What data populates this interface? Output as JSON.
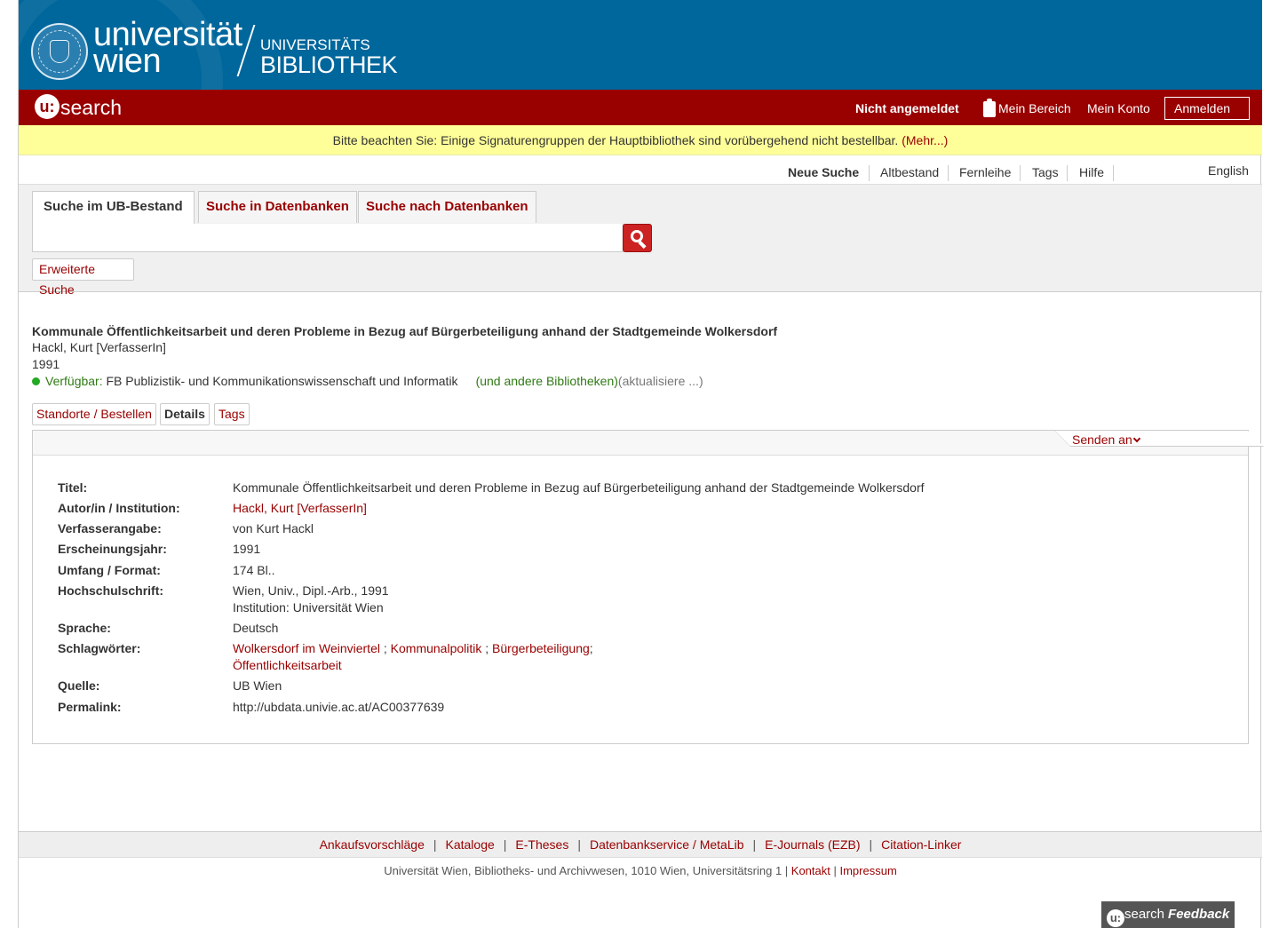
{
  "header": {
    "uni_line1": "universität",
    "uni_line2": "wien",
    "ub_line1": "UNIVERSITÄTS",
    "ub_line2": "BIBLIOTHEK"
  },
  "topbar": {
    "logo_u": "u:",
    "logo_text": "search",
    "login_status": "Nicht angemeldet",
    "mein_bereich": "Mein Bereich",
    "mein_konto": "Mein Konto",
    "anmelden": "Anmelden"
  },
  "notice": {
    "text": "Bitte beachten Sie: Einige Signaturengruppen der Hauptbibliothek sind vorübergehend nicht bestellbar. ",
    "link": "(Mehr...)"
  },
  "nav": {
    "items": [
      "Neue Suche",
      "Altbestand",
      "Fernleihe",
      "Tags",
      "Hilfe"
    ],
    "language": "English"
  },
  "search": {
    "tabs": [
      "Suche im UB-Bestand",
      "Suche in Datenbanken",
      "Suche nach Datenbanken"
    ],
    "query": "",
    "advanced": "Erweiterte Suche"
  },
  "record": {
    "title": "Kommunale Öffentlichkeitsarbeit und deren Probleme in Bezug auf Bürgerbeteiligung anhand der Stadtgemeinde Wolkersdorf",
    "author": "Hackl, Kurt [VerfasserIn]",
    "year": "1991",
    "availability_label": "Verfügbar:",
    "availability_location": " FB Publizistik- und Kommunikationswissenschaft und Informatik",
    "other_libraries": "(und andere Bibliotheken)",
    "updating": "(aktualisiere ...)"
  },
  "detail_tabs": [
    "Standorte / Bestellen",
    "Details",
    "Tags"
  ],
  "send_to": "Senden an",
  "details": {
    "titel_label": "Titel:",
    "titel": "Kommunale Öffentlichkeitsarbeit und deren Probleme in Bezug auf Bürgerbeteiligung anhand der Stadtgemeinde Wolkersdorf",
    "autor_label": "Autor/in / Institution:",
    "autor": "Hackl, Kurt [VerfasserIn]",
    "verfasser_label": "Verfasserangabe:",
    "verfasser": "von Kurt Hackl",
    "jahr_label": "Erscheinungsjahr:",
    "jahr": "1991",
    "umfang_label": "Umfang / Format:",
    "umfang": "174 Bl..",
    "hochschul_label": "Hochschulschrift:",
    "hochschul_1": "Wien, Univ., Dipl.-Arb., 1991",
    "hochschul_2": "Institution: Universität Wien",
    "sprache_label": "Sprache:",
    "sprache": "Deutsch",
    "schlag_label": "Schlagwörter:",
    "schlag": [
      "Wolkersdorf im Weinviertel",
      "Kommunalpolitik",
      "Bürgerbeteiligung",
      "Öffentlichkeitsarbeit"
    ],
    "schlag_sep": " ; ",
    "schlag_end": ";",
    "quelle_label": "Quelle:",
    "quelle": "UB Wien",
    "permalink_label": "Permalink:",
    "permalink": "http://ubdata.univie.ac.at/AC00377639"
  },
  "footer": {
    "links": [
      "Ankaufsvorschläge",
      "Kataloge",
      "E-Theses",
      "Datenbankservice / MetaLib",
      "E-Journals (EZB)",
      "Citation-Linker"
    ],
    "pipe": "|",
    "address": "Universität Wien, Bibliotheks- und Archivwesen, 1010 Wien, Universitätsring 1 | ",
    "kontakt": "Kontakt",
    "sep": " | ",
    "impressum": "Impressum"
  },
  "feedback": {
    "u": "u:",
    "search": "search",
    "label": "Feedback"
  },
  "colors": {
    "header_blue": "#00679c",
    "bar_red": "#990000",
    "notice_yellow": "#ffff99",
    "available_green": "#22aa22"
  }
}
